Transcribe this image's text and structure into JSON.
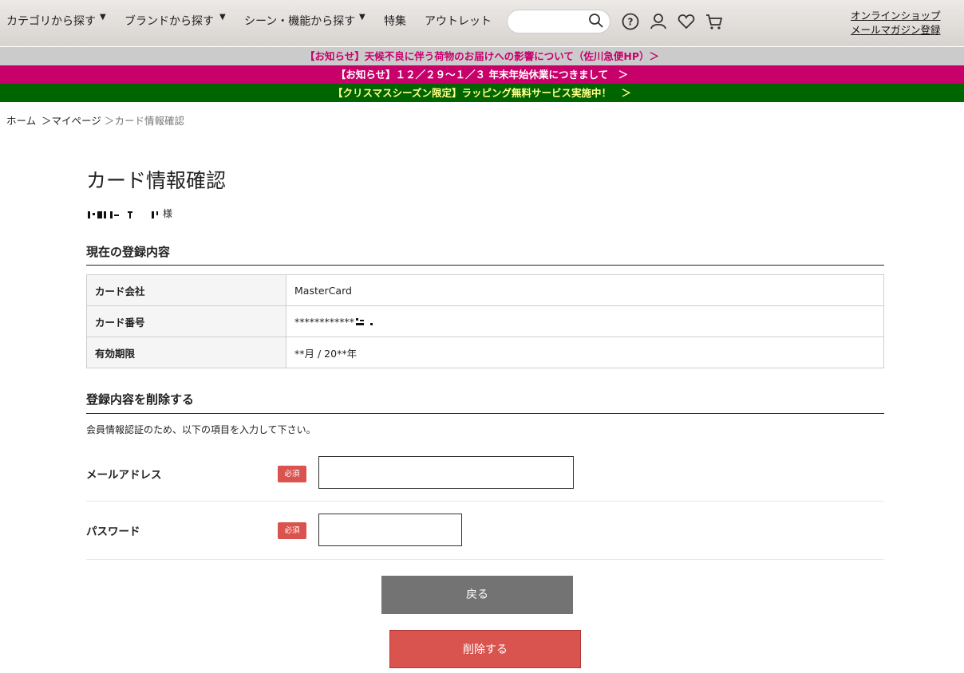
{
  "header": {
    "nav": [
      {
        "label": "カテゴリから探す",
        "arrow": "▼"
      },
      {
        "label": "ブランドから探す",
        "arrow": "▼"
      },
      {
        "label": "シーン・機能から探す",
        "arrow": "▼"
      },
      {
        "label": "特集"
      },
      {
        "label": "アウトレット"
      }
    ],
    "search_placeholder": "",
    "links": [
      "オンラインショップ",
      "メールマガジン登録"
    ]
  },
  "notices": [
    "【お知らせ】天候不良に伴う荷物のお届けへの影響について（佐川急便HP）＞",
    "【お知らせ】１２／２９～１／３ 年末年始休業につきまして　＞",
    "【クリスマスシーズン限定】ラッピング無料サービス実施中！　＞"
  ],
  "breadcrumb": [
    "ホーム",
    "＞マイページ",
    "＞カード情報確認"
  ],
  "page": {
    "title": "カード情報確認",
    "user_suffix": "様",
    "current_section": "現在の登録内容",
    "rows": [
      {
        "label": "カード会社",
        "value": "MasterCard"
      },
      {
        "label": "カード番号",
        "value": "************"
      },
      {
        "label": "有効期限",
        "value": "**月 / 20**年"
      }
    ],
    "delete_section": "登録内容を削除する",
    "description": "会員情報認証のため、以下の項目を入力して下さい。",
    "email_label": "メールアドレス",
    "password_label": "パスワード",
    "required": "必須",
    "back_button": "戻る",
    "delete_button": "削除する"
  }
}
